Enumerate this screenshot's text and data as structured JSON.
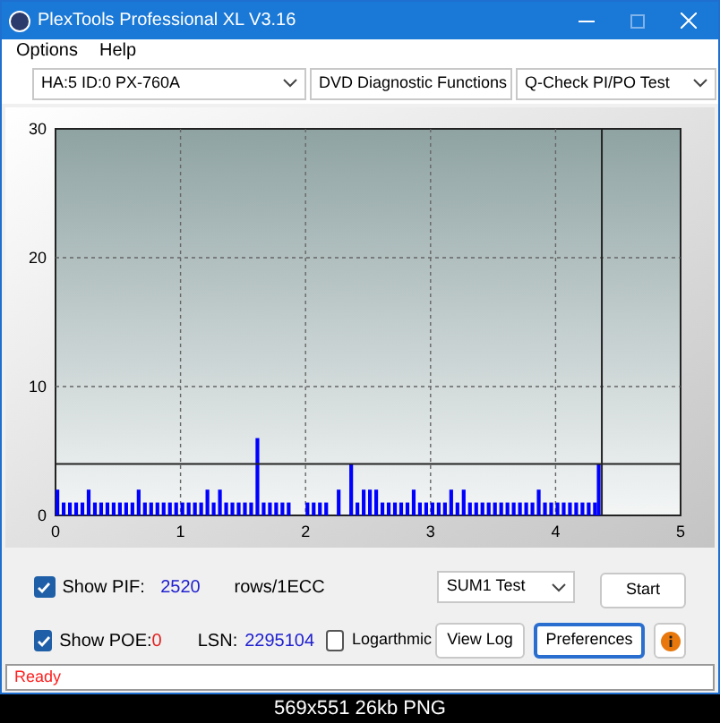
{
  "window": {
    "title": "PlexTools Professional XL V3.16"
  },
  "menu": [
    {
      "label": "Options"
    },
    {
      "label": "Help"
    }
  ],
  "toolbar": [
    {
      "value": "HA:5 ID:0  PX-760A"
    },
    {
      "value": "DVD Diagnostic Functions"
    },
    {
      "value": "Q-Check PI/PO Test"
    }
  ],
  "chart": {
    "chart_data": {
      "type": "bar",
      "xlim": [
        0,
        5
      ],
      "ylim": [
        0,
        30
      ],
      "xticks": [
        0,
        1,
        2,
        3,
        4,
        5
      ],
      "yticks": [
        0,
        10,
        20,
        30
      ],
      "x": [
        0,
        0.05,
        0.1,
        0.15,
        0.2,
        0.25,
        0.3,
        0.35,
        0.4,
        0.45,
        0.5,
        0.55,
        0.6,
        0.65,
        0.7,
        0.75,
        0.8,
        0.85,
        0.9,
        0.95,
        1,
        1.05,
        1.1,
        1.15,
        1.2,
        1.25,
        1.3,
        1.35,
        1.4,
        1.45,
        1.5,
        1.55,
        1.6,
        1.65,
        1.7,
        1.75,
        1.8,
        1.85,
        1.9,
        1.95,
        2,
        2.05,
        2.1,
        2.15,
        2.2,
        2.25,
        2.3,
        2.35,
        2.4,
        2.45,
        2.5,
        2.55,
        2.6,
        2.65,
        2.7,
        2.75,
        2.8,
        2.85,
        2.9,
        2.95,
        3,
        3.05,
        3.1,
        3.15,
        3.2,
        3.25,
        3.3,
        3.35,
        3.4,
        3.45,
        3.5,
        3.55,
        3.6,
        3.65,
        3.7,
        3.75,
        3.8,
        3.85,
        3.9,
        3.95,
        4,
        4.05,
        4.1,
        4.15,
        4.2,
        4.25,
        4.3,
        4.33
      ],
      "series": [
        {
          "color": "#0000ff",
          "values": [
            2,
            1,
            1,
            1,
            1,
            2,
            1,
            1,
            1,
            1,
            1,
            1,
            1,
            2,
            1,
            1,
            1,
            1,
            1,
            1,
            1,
            1,
            1,
            1,
            2,
            1,
            2,
            1,
            1,
            1,
            1,
            1,
            6,
            1,
            1,
            1,
            1,
            1,
            0,
            0,
            1,
            1,
            1,
            1,
            0,
            2,
            0,
            4,
            1,
            2,
            2,
            2,
            1,
            1,
            1,
            1,
            1,
            2,
            1,
            1,
            1,
            1,
            1,
            2,
            1,
            2,
            1,
            1,
            1,
            1,
            1,
            1,
            1,
            1,
            1,
            1,
            1,
            2,
            1,
            1,
            1,
            1,
            1,
            1,
            1,
            1,
            1,
            4
          ]
        }
      ],
      "grid": true,
      "ref_lines": [
        {
          "axis": "y",
          "value": 4
        },
        {
          "axis": "x",
          "value": 4.37
        }
      ]
    }
  },
  "controls": {
    "show_pif": {
      "label": "Show PIF:",
      "checked": true,
      "value": "2520",
      "unit": "rows/1ECC"
    },
    "show_poe": {
      "label": "Show POE:",
      "checked": true,
      "value": "0"
    },
    "lsn": {
      "label": "LSN:",
      "value": "2295104"
    },
    "logarithmic": {
      "label": "Logarthmic",
      "checked": false
    },
    "test_select": {
      "value": "SUM1 Test"
    },
    "buttons": [
      {
        "label": "Start",
        "focused": false
      },
      {
        "label": "View Log",
        "focused": false
      },
      {
        "label": "Preferences",
        "focused": true
      }
    ]
  },
  "status_bar": {
    "text": "Ready"
  },
  "caption": "569x551 26kb PNG"
}
